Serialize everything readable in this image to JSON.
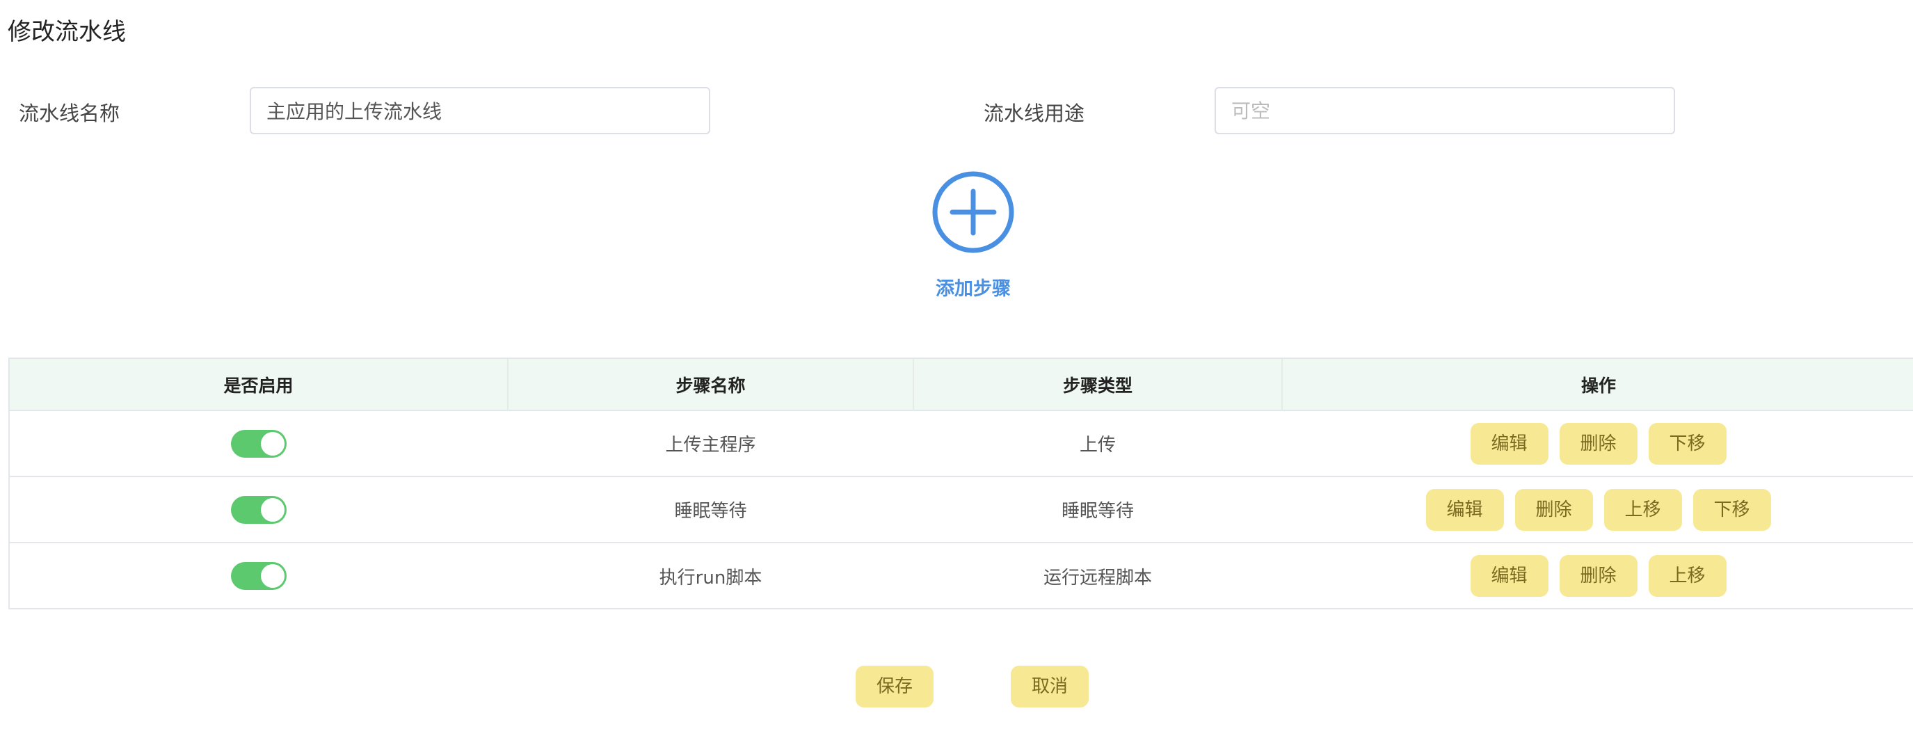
{
  "page": {
    "title": "修改流水线"
  },
  "form": {
    "name_label": "流水线名称",
    "name_value": "主应用的上传流水线",
    "purpose_label": "流水线用途",
    "purpose_placeholder": "可空"
  },
  "add_step": {
    "label": "添加步骤",
    "icon": "plus-circle-icon"
  },
  "table": {
    "headers": [
      "是否启用",
      "步骤名称",
      "步骤类型",
      "操作"
    ],
    "rows": [
      {
        "enabled": true,
        "name": "上传主程序",
        "type": "上传",
        "actions": [
          "编辑",
          "删除",
          "下移"
        ]
      },
      {
        "enabled": true,
        "name": "睡眠等待",
        "type": "睡眠等待",
        "actions": [
          "编辑",
          "删除",
          "上移",
          "下移"
        ]
      },
      {
        "enabled": true,
        "name": "执行run脚本",
        "type": "运行远程脚本",
        "actions": [
          "编辑",
          "删除",
          "上移"
        ]
      }
    ]
  },
  "footer": {
    "save_label": "保存",
    "cancel_label": "取消"
  },
  "colors": {
    "accent": "#4a90e2",
    "toggle_on": "#5cc96f",
    "action_button": "#f7e893",
    "header_bg": "#f0f8f3"
  }
}
